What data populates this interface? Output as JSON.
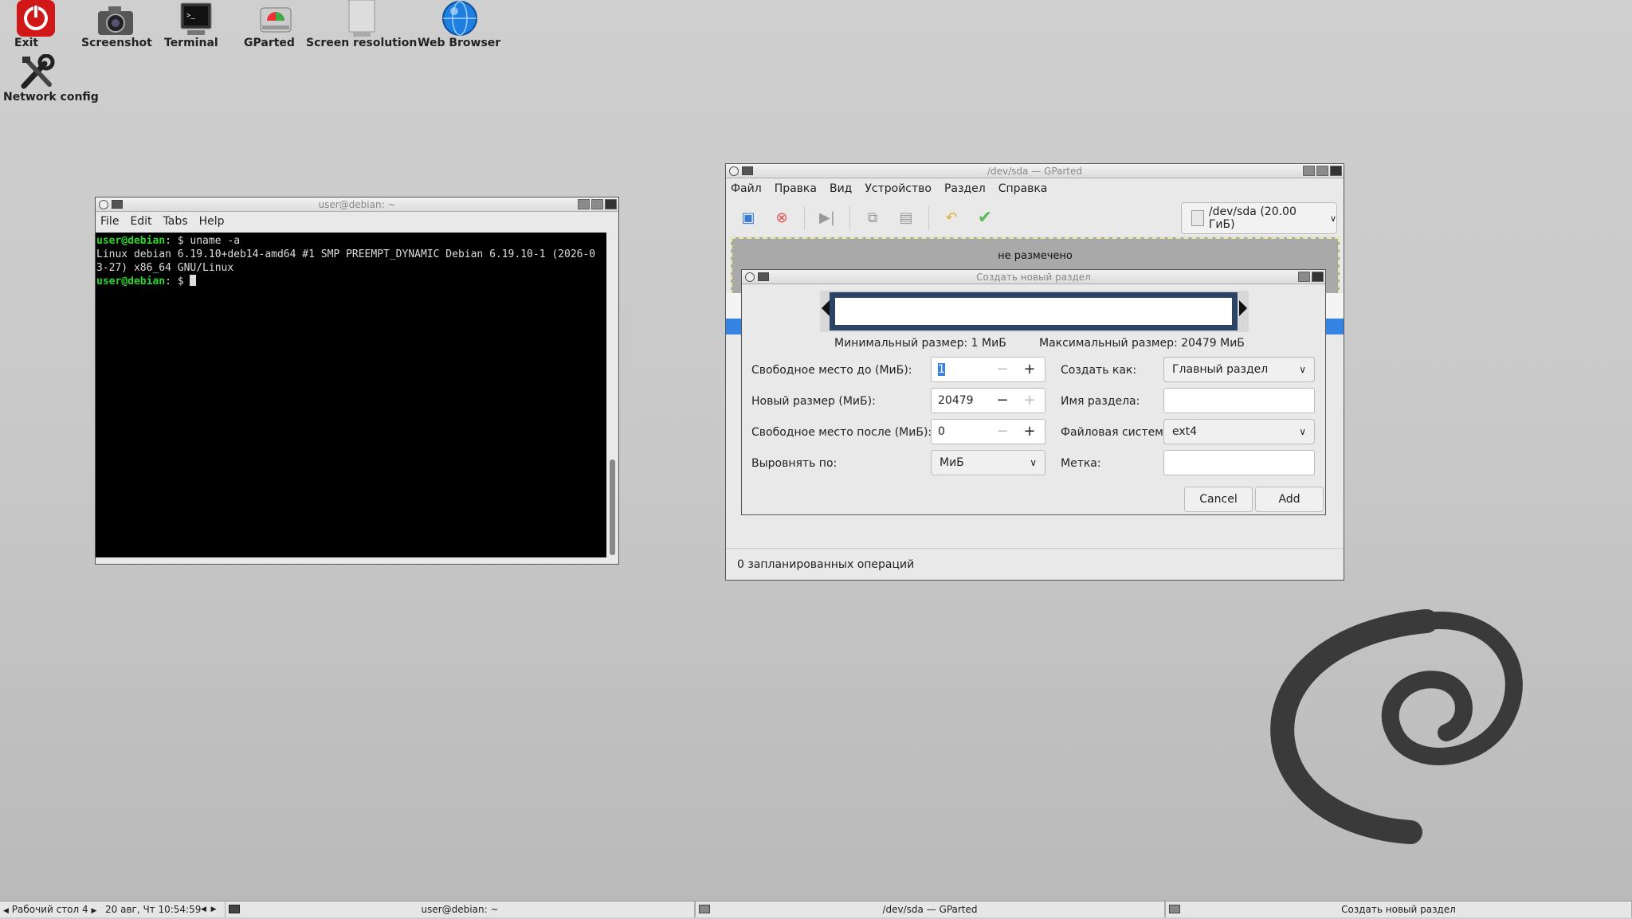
{
  "desktop_icons": [
    {
      "label": "Exit",
      "icon": "power-icon"
    },
    {
      "label": "Screenshot",
      "icon": "camera-icon"
    },
    {
      "label": "Terminal",
      "icon": "terminal-icon"
    },
    {
      "label": "GParted",
      "icon": "gparted-icon"
    },
    {
      "label": "Screen resolution",
      "icon": "monitor-icon"
    },
    {
      "label": "Web Browser",
      "icon": "globe-icon"
    },
    {
      "label": "Network config",
      "icon": "tools-icon"
    }
  ],
  "terminal": {
    "title": "user@debian: ~",
    "menu": [
      "File",
      "Edit",
      "Tabs",
      "Help"
    ],
    "prompt": "user@debian",
    "prompt_suffix": ": $ ",
    "command": "uname -a",
    "output_line1": "Linux debian 6.19.10+deb14-amd64 #1 SMP PREEMPT_DYNAMIC Debian 6.19.10-1 (2026-0",
    "output_line2": "3-27) x86_64 GNU/Linux"
  },
  "gparted": {
    "title": "/dev/sda — GParted",
    "menu": [
      "Файл",
      "Правка",
      "Вид",
      "Устройство",
      "Раздел",
      "Справка"
    ],
    "device": "/dev/sda (20.00 ГиБ)",
    "unallocated": "не размечено",
    "status": "0 запланированных операций"
  },
  "dialog": {
    "title": "Создать новый раздел",
    "min_size": "Минимальный размер: 1 МиБ",
    "max_size": "Максимальный размер: 20479 МиБ",
    "free_before_label": "Свободное место до (МиБ):",
    "free_before_value": "1",
    "new_size_label": "Новый размер (МиБ):",
    "new_size_value": "20479",
    "free_after_label": "Свободное место после (МиБ):",
    "free_after_value": "0",
    "align_label": "Выровнять по:",
    "align_value": "МиБ",
    "create_as_label": "Создать как:",
    "create_as_value": "Главный раздел",
    "partition_name_label": "Имя раздела:",
    "partition_name_value": "",
    "filesystem_label": "Файловая система:",
    "filesystem_value": "ext4",
    "label_label": "Метка:",
    "label_value": "",
    "cancel": "Cancel",
    "add": "Add"
  },
  "taskbar": {
    "workspace": "Рабочий стол 4",
    "clock": "20 авг, Чт 10:54:59",
    "task1": "user@debian: ~",
    "task2": "/dev/sda — GParted",
    "task3": "Создать новый раздел"
  }
}
